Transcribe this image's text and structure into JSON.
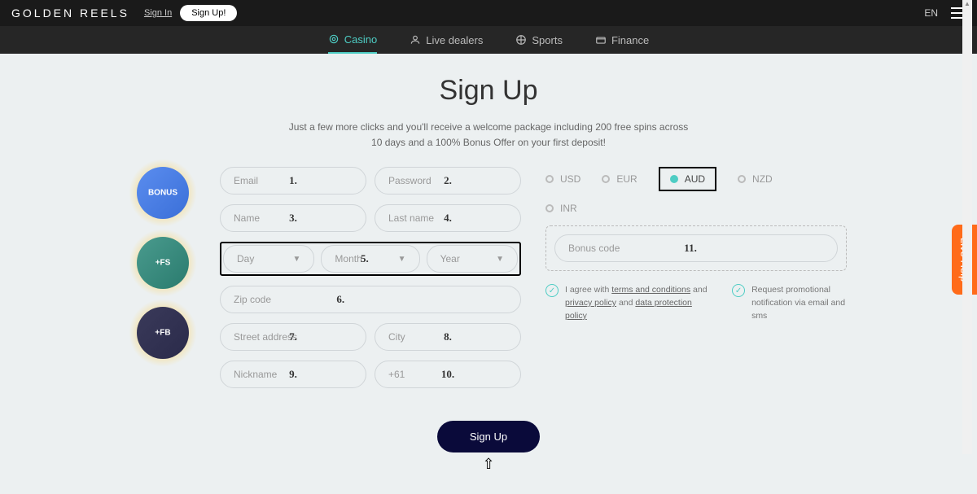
{
  "header": {
    "logo": "GOLDEN REELS",
    "signin": "Sign In",
    "signup": "Sign Up!",
    "lang": "EN"
  },
  "nav": {
    "items": [
      {
        "label": "Casino",
        "active": true
      },
      {
        "label": "Live dealers",
        "active": false
      },
      {
        "label": "Sports",
        "active": false
      },
      {
        "label": "Finance",
        "active": false
      }
    ]
  },
  "page": {
    "title": "Sign Up",
    "subtitle_line1": "Just a few more clicks and you'll receive a welcome package including 200 free spins across",
    "subtitle_line2": "10 days and a 100% Bonus Offer on your first deposit!"
  },
  "form": {
    "email": {
      "placeholder": "Email",
      "marker": "1."
    },
    "password": {
      "placeholder": "Password",
      "marker": "2."
    },
    "name": {
      "placeholder": "Name",
      "marker": "3."
    },
    "lastname": {
      "placeholder": "Last name",
      "marker": "4."
    },
    "dob": {
      "day": {
        "placeholder": "Day"
      },
      "month": {
        "placeholder": "Month",
        "marker": "5."
      },
      "year": {
        "placeholder": "Year"
      }
    },
    "zip": {
      "placeholder": "Zip code",
      "marker": "6."
    },
    "street": {
      "placeholder": "Street address",
      "marker": "7."
    },
    "city": {
      "placeholder": "City",
      "marker": "8."
    },
    "nickname": {
      "placeholder": "Nickname",
      "marker": "9."
    },
    "phone": {
      "prefix": "+61",
      "marker": "10."
    },
    "bonus": {
      "placeholder": "Bonus code",
      "marker": "11."
    }
  },
  "currencies": [
    "USD",
    "EUR",
    "AUD",
    "NZD",
    "INR"
  ],
  "currency_selected": "AUD",
  "agree": {
    "terms_text_pre": "I agree with ",
    "terms_link": "terms and conditions",
    "terms_and": " and ",
    "privacy_link": "privacy policy",
    "data_and": " and ",
    "data_link": "data protection policy",
    "promo_text": "Request promotional notification via email and sms"
  },
  "submit": "Sign Up",
  "help_tab": "Live Help",
  "promo_badges": [
    "BONUS",
    "+FS",
    "+FB"
  ]
}
